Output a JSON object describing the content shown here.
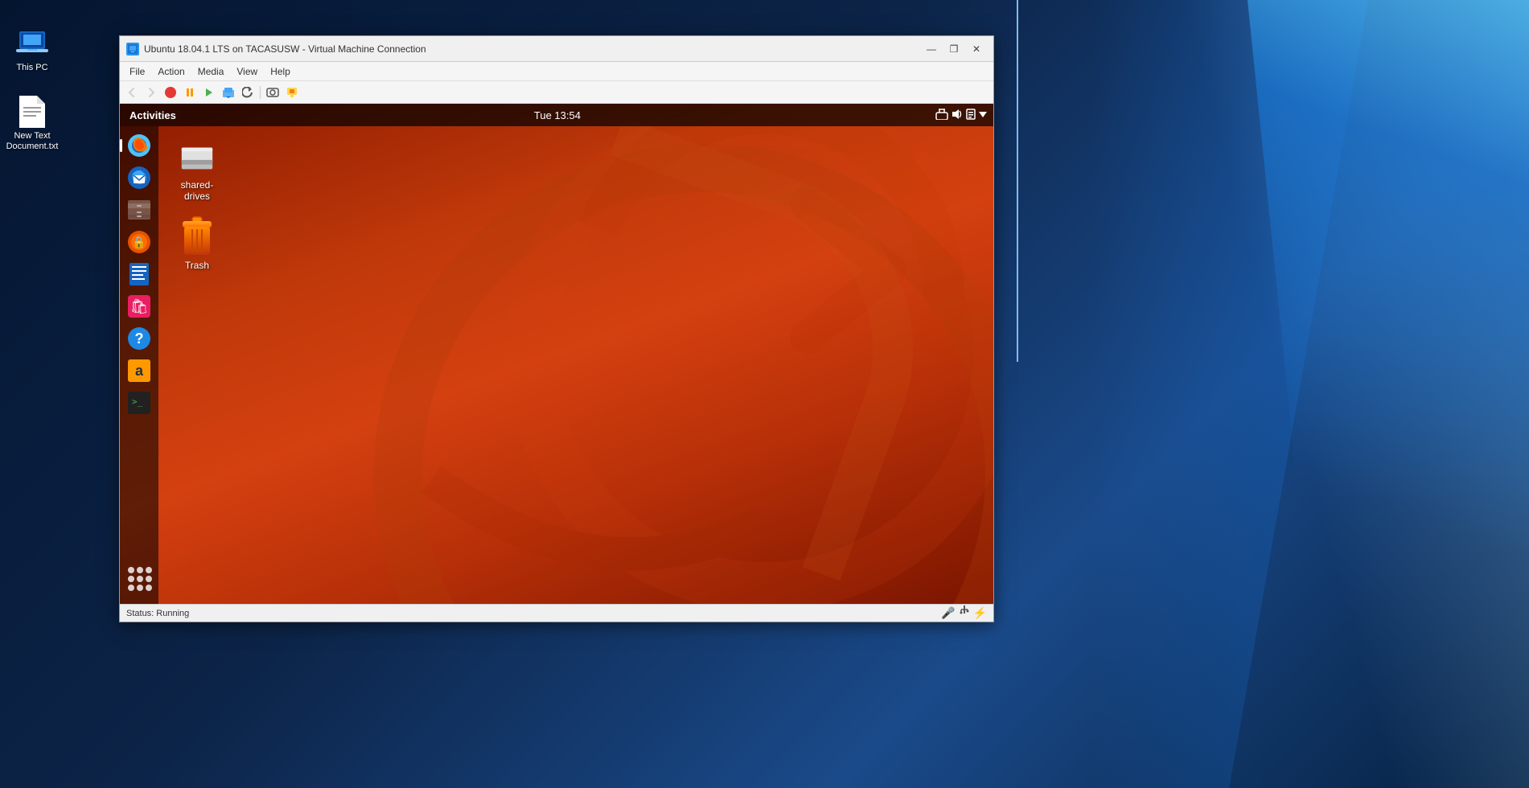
{
  "windows_desktop": {
    "this_pc_label": "This PC",
    "new_text_doc_label": "New Text\nDocument.txt"
  },
  "vm_window": {
    "title": "Ubuntu 18.04.1 LTS on TACASUSW - Virtual Machine Connection",
    "icon_label": "vm-icon",
    "controls": {
      "minimize": "—",
      "restore": "❐",
      "close": "✕"
    },
    "menu": {
      "file": "File",
      "action": "Action",
      "media": "Media",
      "view": "View",
      "help": "Help"
    },
    "status_bar": {
      "status_text": "Status: Running"
    }
  },
  "ubuntu": {
    "activities": "Activities",
    "clock": "Tue 13:54",
    "desktop_icons": {
      "shared_drives": "shared-drives",
      "trash": "Trash"
    },
    "dock": {
      "items": [
        {
          "name": "firefox",
          "label": "Firefox"
        },
        {
          "name": "email",
          "label": "Thunderbird"
        },
        {
          "name": "files",
          "label": "Files"
        },
        {
          "name": "privacy",
          "label": "Privacy"
        },
        {
          "name": "writer",
          "label": "LibreOffice Writer"
        },
        {
          "name": "appstore",
          "label": "Ubuntu Software"
        },
        {
          "name": "help",
          "label": "Help"
        },
        {
          "name": "amazon",
          "label": "Amazon"
        },
        {
          "name": "terminal",
          "label": "Terminal"
        }
      ]
    }
  }
}
